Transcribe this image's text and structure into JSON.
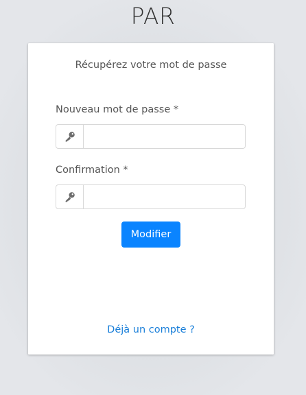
{
  "app": {
    "title": "PAR"
  },
  "form": {
    "subtitle": "Récupérez votre mot de passe",
    "new_password_label": "Nouveau mot de passe *",
    "new_password_value": "",
    "confirmation_label": "Confirmation *",
    "confirmation_value": "",
    "submit_label": "Modifier",
    "login_link_label": "Déjà un compte ?"
  },
  "icons": {
    "new_password_addon": "key-icon",
    "confirmation_addon": "key-icon"
  },
  "colors": {
    "accent": "#0a84ff",
    "link": "#1a7fd9"
  }
}
